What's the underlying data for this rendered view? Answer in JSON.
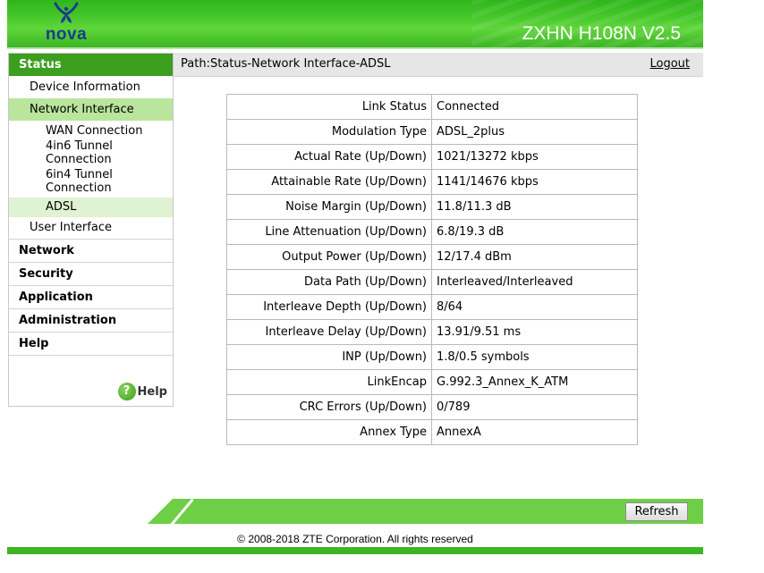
{
  "header": {
    "brand": "nova",
    "model": "ZXHN H108N V2.5"
  },
  "path": {
    "label": "Path:Status-Network Interface-ADSL",
    "logout": "Logout"
  },
  "sidebar": {
    "status": "Status",
    "device_information": "Device Information",
    "network_interface": "Network Interface",
    "wan_connection": "WAN Connection",
    "tunnel_4in6": "4in6 Tunnel Connection",
    "tunnel_6in4": "6in4 Tunnel Connection",
    "adsl": "ADSL",
    "user_interface": "User Interface",
    "network": "Network",
    "security": "Security",
    "application": "Application",
    "administration": "Administration",
    "help": "Help",
    "help_link": "Help",
    "help_icon_glyph": "?"
  },
  "table": {
    "rows": [
      {
        "label": "Link Status",
        "value": "Connected"
      },
      {
        "label": "Modulation Type",
        "value": "ADSL_2plus"
      },
      {
        "label": "Actual Rate (Up/Down)",
        "value": "1021/13272 kbps"
      },
      {
        "label": "Attainable Rate (Up/Down)",
        "value": "1141/14676 kbps"
      },
      {
        "label": "Noise Margin (Up/Down)",
        "value": "11.8/11.3 dB"
      },
      {
        "label": "Line Attenuation (Up/Down)",
        "value": "6.8/19.3 dB"
      },
      {
        "label": "Output Power (Up/Down)",
        "value": "12/17.4 dBm"
      },
      {
        "label": "Data Path (Up/Down)",
        "value": "Interleaved/Interleaved"
      },
      {
        "label": "Interleave Depth (Up/Down)",
        "value": "8/64"
      },
      {
        "label": "Interleave Delay (Up/Down)",
        "value": "13.91/9.51 ms"
      },
      {
        "label": "INP (Up/Down)",
        "value": "1.8/0.5 symbols"
      },
      {
        "label": "LinkEncap",
        "value": "G.992.3_Annex_K_ATM"
      },
      {
        "label": "CRC Errors (Up/Down)",
        "value": "0/789"
      },
      {
        "label": "Annex Type",
        "value": "AnnexA"
      }
    ]
  },
  "footer": {
    "refresh": "Refresh",
    "copyright": "© 2008-2018 ZTE Corporation. All rights reserved"
  },
  "colors": {
    "header_green": "#46c72a",
    "active_menu": "#3c9e1e",
    "active_sub": "#b9e59d",
    "brand_blue": "#1a3c8c"
  }
}
